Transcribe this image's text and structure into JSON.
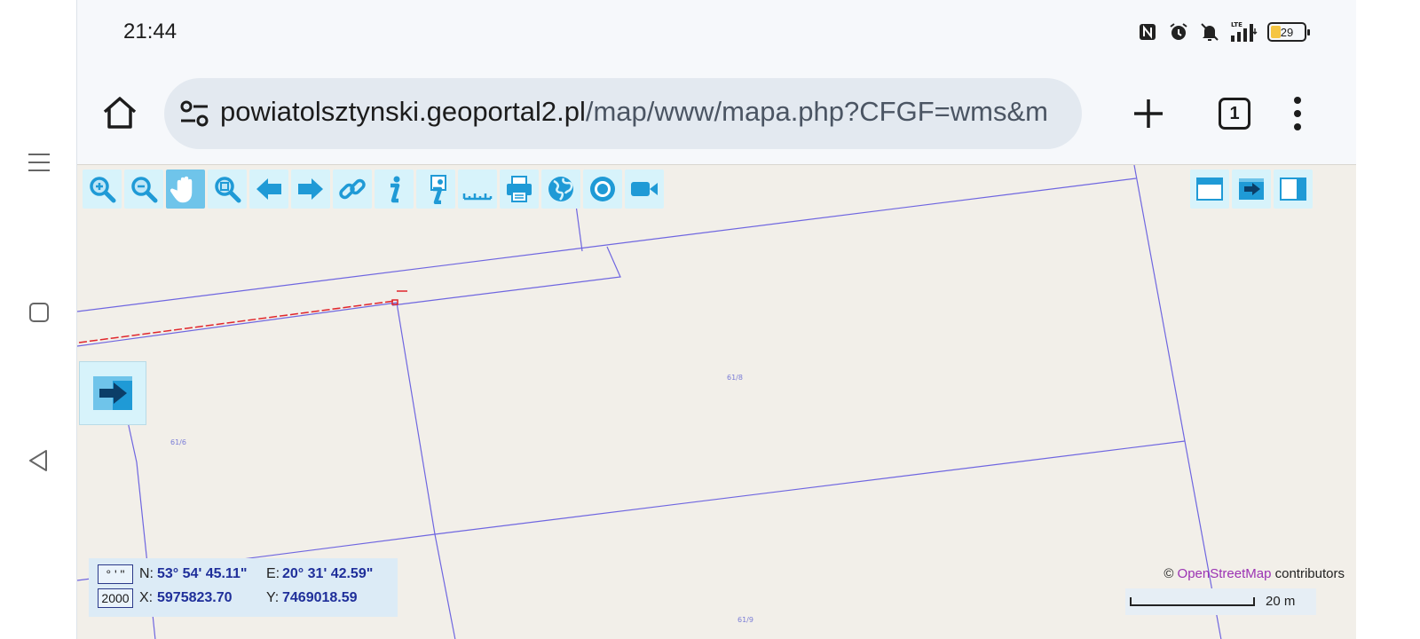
{
  "status_bar": {
    "time": "21:44",
    "icons": [
      "nfc-icon",
      "alarm-icon",
      "mute-icon",
      "lte-signal-icon"
    ],
    "lte_label": "LTE",
    "battery": "29"
  },
  "nav": [
    "menu-icon",
    "home-square-icon",
    "back-triangle-icon"
  ],
  "browser": {
    "url_domain": "powiatolsztynski.geoportal2.pl",
    "url_path": "/map/www/mapa.php?CFGF=wms&m",
    "tab_count": "1"
  },
  "map_tools": [
    "zoom-in-icon",
    "zoom-out-icon",
    "pan-hand-icon",
    "zoom-box-icon",
    "arrow-left-icon",
    "arrow-right-icon",
    "link-icon",
    "info-icon",
    "info-layer-icon",
    "ruler-icon",
    "print-icon",
    "globe-icon",
    "target-icon",
    "video-camera-icon"
  ],
  "map_tools_right": [
    "window-icon",
    "panel-arrow-icon",
    "sidebar-right-icon"
  ],
  "parcels": [
    "61/8",
    "61/6",
    "61/9"
  ],
  "coordinates": {
    "format_dms": "° ' \"",
    "format_2000": "2000",
    "n_label": "N:",
    "n_value": "53° 54' 45.11\"",
    "e_label": "E:",
    "e_value": "20° 31' 42.59\"",
    "x_label": "X:",
    "x_value": "5975823.70",
    "y_label": "Y:",
    "y_value": "7469018.59"
  },
  "attribution": {
    "prefix": "©",
    "osm": "OpenStreetMap",
    "suffix": "contributors"
  },
  "scale": "20 m",
  "colors": {
    "parcel_line": "#6f66e0",
    "highlight": "#e0262c",
    "tool_bg": "#d7f3fb",
    "tool_icon": "#1f9ad6"
  }
}
